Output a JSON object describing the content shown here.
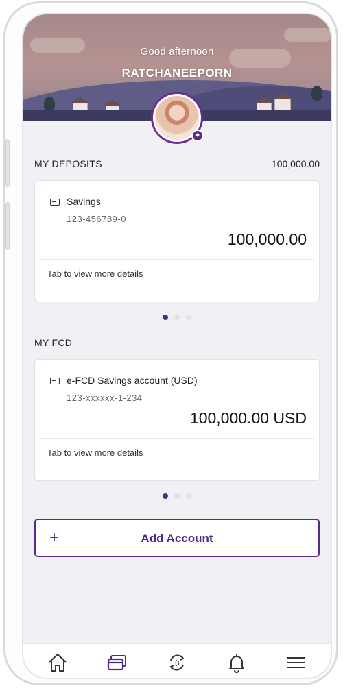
{
  "header": {
    "greeting": "Good afternoon",
    "username": "RATCHANEEPORN"
  },
  "deposits": {
    "section_title": "MY DEPOSITS",
    "total": "100,000.00",
    "account": {
      "name": "Savings",
      "number": "123-456789-0",
      "balance": "100,000.00",
      "details_label": "Tab to view more details"
    }
  },
  "fcd": {
    "section_title": "MY FCD",
    "account": {
      "name": "e-FCD Savings account (USD)",
      "number": "123-xxxxxx-1-234",
      "balance": "100,000.00 USD",
      "details_label": "Tab to view more details"
    }
  },
  "add_account": {
    "plus": "+",
    "label": "Add Account"
  },
  "tabbar": {
    "items": [
      {
        "icon": "home-icon",
        "active": false
      },
      {
        "icon": "accounts-card-icon",
        "active": true
      },
      {
        "icon": "transfer-icon",
        "active": false
      },
      {
        "icon": "bell-icon",
        "active": false
      },
      {
        "icon": "menu-icon",
        "active": false
      }
    ]
  },
  "colors": {
    "accent": "#5a2a88",
    "background": "#f1f0f5",
    "card": "#ffffff"
  },
  "pagination": {
    "deposits": {
      "count": 3,
      "active": 1
    },
    "fcd": {
      "count": 3,
      "active": 1
    }
  }
}
